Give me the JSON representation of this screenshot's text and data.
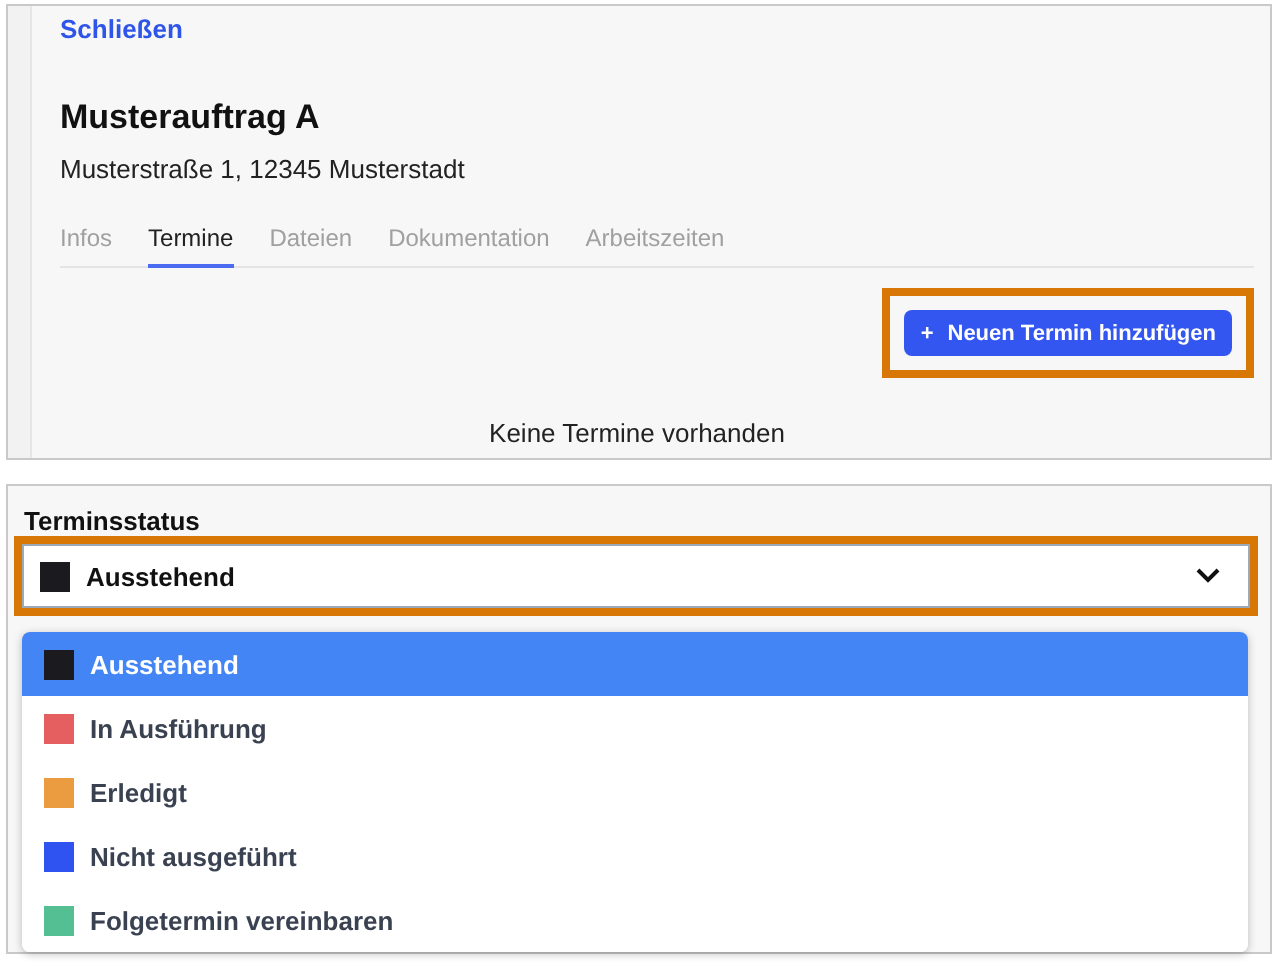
{
  "close_link": "Schließen",
  "order": {
    "title": "Musterauftrag A",
    "address": "Musterstraße 1, 12345 Musterstadt"
  },
  "tabs": [
    {
      "label": "Infos",
      "selected": false
    },
    {
      "label": "Termine",
      "selected": true
    },
    {
      "label": "Dateien",
      "selected": false
    },
    {
      "label": "Dokumentation",
      "selected": false
    },
    {
      "label": "Arbeitszeiten",
      "selected": false
    }
  ],
  "add_button": {
    "icon": "+",
    "label": "Neuen Termin hinzufügen"
  },
  "empty_message": "Keine Termine vorhanden",
  "status_field": {
    "label": "Terminsstatus",
    "value": "Ausstehend",
    "color": "#1a1a1f"
  },
  "status_options": [
    {
      "label": "Ausstehend",
      "color": "#1a1a1f",
      "selected": true
    },
    {
      "label": "In Ausführung",
      "color": "#e55f60",
      "selected": false
    },
    {
      "label": "Erledigt",
      "color": "#eb9b40",
      "selected": false
    },
    {
      "label": "Nicht ausgeführt",
      "color": "#2e53f0",
      "selected": false
    },
    {
      "label": "Folgetermin vereinbaren",
      "color": "#55bf94",
      "selected": false
    }
  ]
}
